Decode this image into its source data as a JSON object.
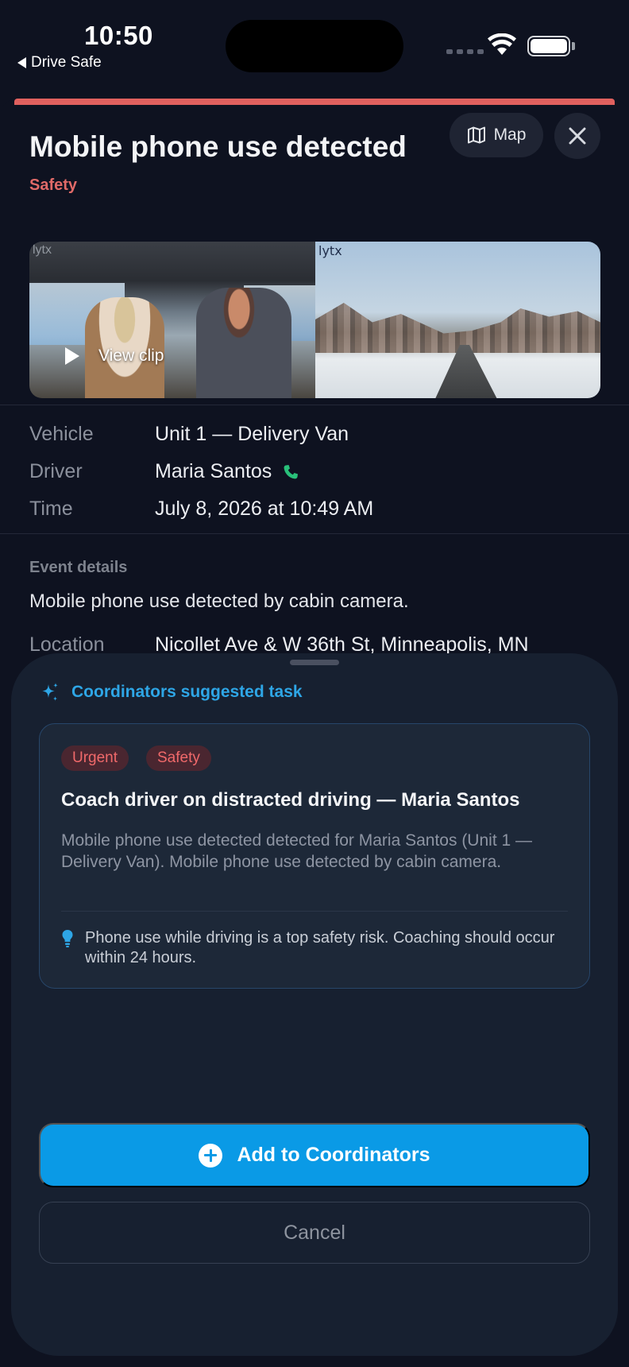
{
  "status_bar": {
    "time": "10:50",
    "back_app": "Drive Safe",
    "icons": [
      "signal-dots-icon",
      "wifi-icon",
      "battery-icon"
    ]
  },
  "event": {
    "title": "Mobile phone use detected",
    "category": "Safety",
    "category_color": "#e06a68",
    "accent_color": "#e0605e",
    "map_button": "Map",
    "close_icon": "close-icon",
    "video": {
      "play_label": "View clip",
      "brand": "lytx"
    },
    "info": [
      {
        "label": "Vehicle",
        "value": "Unit 1 — Delivery Van"
      },
      {
        "label": "Driver",
        "value": "Maria Santos"
      },
      {
        "label": "Time",
        "value": "July 8, 2026 at 10:49 AM"
      }
    ],
    "details_label": "Event details",
    "details_text": "Mobile phone use detected by cabin camera.",
    "location_label": "Location",
    "location_value": "Nicollet Ave & W 36th St, Minneapolis, MN"
  },
  "suggestion": {
    "header": "Coordinators suggested task",
    "accent_color": "#2ea6e6",
    "tags": [
      "Urgent",
      "Safety"
    ],
    "task_title": "Coach driver on distracted driving — Maria Santos",
    "task_description": "Mobile phone use detected detected for Maria Santos (Unit 1 — Delivery Van). Mobile phone use detected by cabin camera.",
    "tip": "Phone use while driving is a top safety risk. Coaching should occur within 24 hours.",
    "primary_button": "Add to Coordinators",
    "primary_color": "#0a9ae6",
    "cancel_button": "Cancel"
  }
}
